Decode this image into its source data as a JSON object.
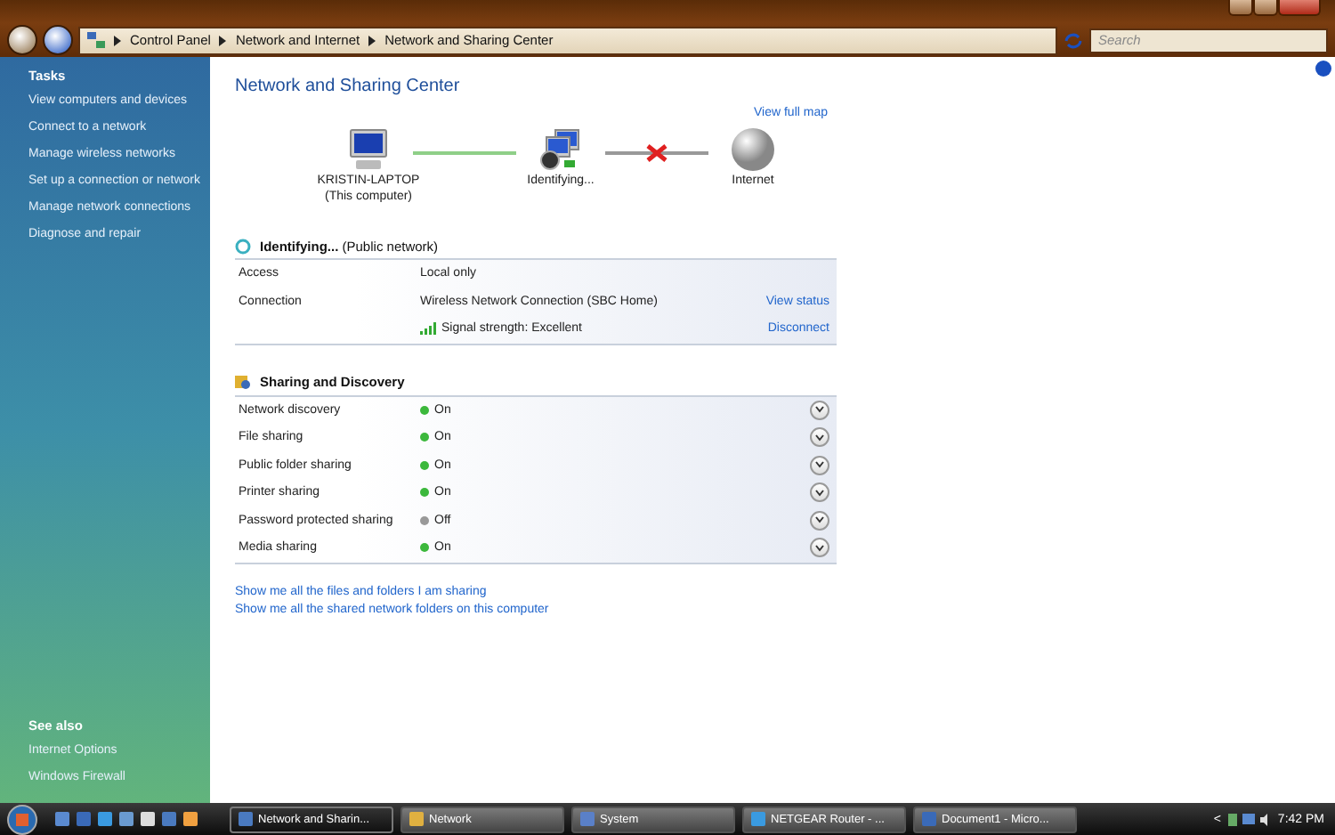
{
  "window": {
    "breadcrumb": [
      "Control Panel",
      "Network and Internet",
      "Network and Sharing Center"
    ],
    "search": {
      "placeholder": "Search"
    }
  },
  "sidebar": {
    "tasks_title": "Tasks",
    "tasks": [
      "View computers and devices",
      "Connect to a network",
      "Manage wireless networks",
      "Set up a connection or network",
      "Manage network connections",
      "Diagnose and repair"
    ],
    "see_also_title": "See also",
    "see_also": [
      "Internet Options",
      "Windows Firewall"
    ]
  },
  "page_title": "Network and Sharing Center",
  "map": {
    "link": "View full map",
    "nodes": [
      {
        "kind": "computer",
        "label": "KRISTIN-LAPTOP",
        "sublabel": "(This computer)"
      },
      {
        "kind": "network",
        "label": "Identifying..."
      },
      {
        "kind": "globe",
        "label": "Internet"
      }
    ],
    "links": [
      {
        "ok": true
      },
      {
        "ok": false
      }
    ]
  },
  "network": {
    "name": "Identifying...",
    "type": "(Public network)",
    "rows": [
      {
        "label": "Access",
        "value": "Local only"
      },
      {
        "label": "Connection",
        "value": "Wireless Network Connection (SBC Home)",
        "action": "View status"
      },
      {
        "kind": "signal",
        "value": "Signal strength:  Excellent",
        "action": "Disconnect"
      }
    ]
  },
  "sharing": {
    "title": "Sharing and Discovery",
    "rows": [
      {
        "label": "Network discovery",
        "state": "On",
        "on": true
      },
      {
        "label": "File sharing",
        "state": "On",
        "on": true
      },
      {
        "label": "Public folder sharing",
        "state": "On",
        "on": true
      },
      {
        "label": "Printer sharing",
        "state": "On",
        "on": true
      },
      {
        "label": "Password protected sharing",
        "state": "Off",
        "on": false
      },
      {
        "label": "Media sharing",
        "state": "On",
        "on": true
      }
    ]
  },
  "links": [
    "Show me all the files and folders I am sharing",
    "Show me all the shared network folders on this computer"
  ],
  "taskbar": {
    "tasks": [
      {
        "kind": "network",
        "label": "Network and Sharin...",
        "selected": true
      },
      {
        "kind": "folder",
        "label": "Network",
        "selected": false
      },
      {
        "kind": "system",
        "label": "System",
        "selected": false
      },
      {
        "kind": "browser",
        "label": "NETGEAR Router - ...",
        "selected": false
      },
      {
        "kind": "document",
        "label": "Document1 - Micro...",
        "selected": false
      }
    ],
    "tray_arrow": "<",
    "clock": "7:42 PM"
  }
}
